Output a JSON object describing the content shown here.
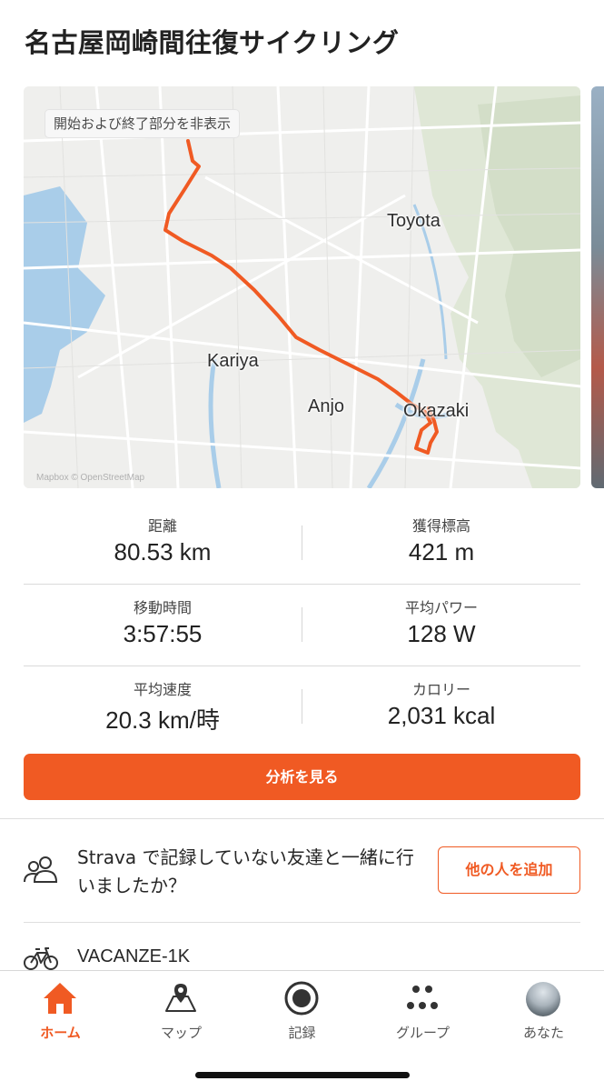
{
  "activity": {
    "title": "名古屋岡崎間往復サイクリング"
  },
  "map": {
    "toggle_label": "開始および終了部分を非表示",
    "cities": [
      "Toyota",
      "Kariya",
      "Anjo",
      "Okazaki"
    ],
    "attribution": "Mapbox © OpenStreetMap",
    "route_color": "#f05a23"
  },
  "stats": [
    {
      "label": "距離",
      "value": "80.53 km"
    },
    {
      "label": "獲得標高",
      "value": "421 m"
    },
    {
      "label": "移動時間",
      "value": "3:57:55"
    },
    {
      "label": "平均パワー",
      "value": "128 W"
    },
    {
      "label": "平均速度",
      "value": "20.3 km/時"
    },
    {
      "label": "カロリー",
      "value": "2,031 kcal"
    }
  ],
  "analysis_button": "分析を見る",
  "friends": {
    "prompt": "Strava で記録していない友達と一緒に行いましたか？",
    "add_button": "他の人を追加"
  },
  "gear": {
    "icon": "bike-icon",
    "name": "VACANZE-1K"
  },
  "tabbar": {
    "items": [
      {
        "label": "ホーム",
        "icon": "home-icon",
        "active": true
      },
      {
        "label": "マップ",
        "icon": "map-icon",
        "active": false
      },
      {
        "label": "記録",
        "icon": "record-icon",
        "active": false
      },
      {
        "label": "グループ",
        "icon": "groups-icon",
        "active": false
      },
      {
        "label": "あなた",
        "icon": "avatar",
        "active": false
      }
    ]
  },
  "colors": {
    "accent": "#f05a23"
  }
}
